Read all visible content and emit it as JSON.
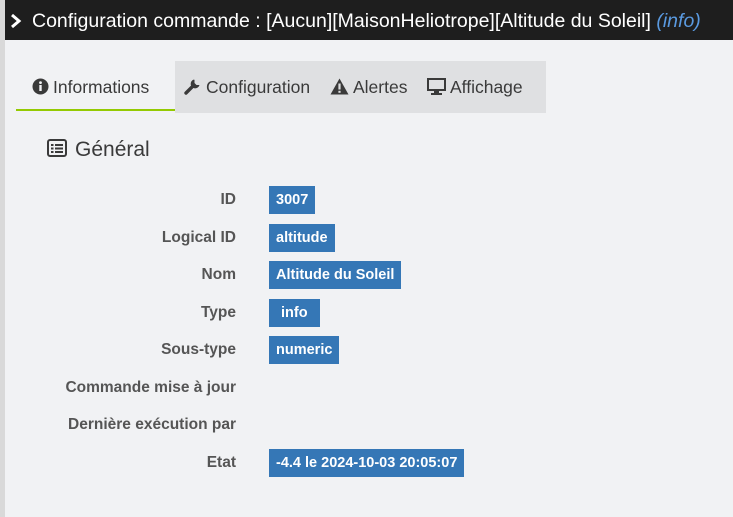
{
  "dialog": {
    "title": "Configuration commande : [Aucun][MaisonHeliotrope][Altitude du Soleil]",
    "subtype_label": "(info)"
  },
  "tabs": [
    {
      "label": "Informations",
      "icon": "info-circle-icon",
      "active": true
    },
    {
      "label": "Configuration",
      "icon": "wrench-icon",
      "active": false
    },
    {
      "label": "Alertes",
      "icon": "warning-icon",
      "active": false
    },
    {
      "label": "Affichage",
      "icon": "desktop-icon",
      "active": false
    }
  ],
  "section": {
    "title": "Général",
    "icon": "list-icon"
  },
  "fields": [
    {
      "label": "ID",
      "value": "3007"
    },
    {
      "label": "Logical ID",
      "value": "altitude"
    },
    {
      "label": "Nom",
      "value": "Altitude du Soleil"
    },
    {
      "label": "Type",
      "value": "info"
    },
    {
      "label": "Sous-type",
      "value": "numeric"
    },
    {
      "label": "Commande mise à jour",
      "value": ""
    },
    {
      "label": "Dernière exécution par",
      "value": ""
    },
    {
      "label": "Etat",
      "value": "-4.4 le 2024-10-03 20:05:07"
    }
  ],
  "colors": {
    "title_bar": "#1e1e1e",
    "badge": "#3577b6",
    "active_tab_underline": "#94ca02",
    "subtitle_link": "#5a9ae0"
  }
}
